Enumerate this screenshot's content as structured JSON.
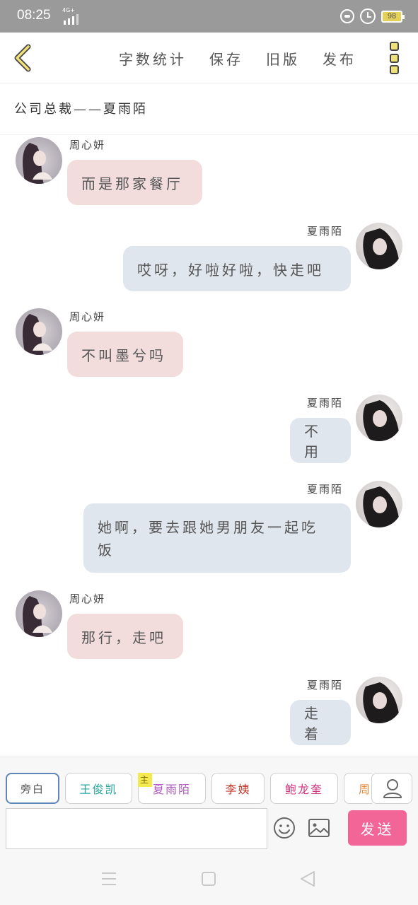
{
  "status": {
    "time": "08:25",
    "network": "4G+",
    "battery": "98"
  },
  "toolbar": {
    "actions": [
      "字数统计",
      "保存",
      "旧版",
      "发布"
    ]
  },
  "title": "公司总裁——夏雨陌",
  "messages": [
    {
      "side": "left",
      "name": "周心妍",
      "text": "而是那家餐厅",
      "color": "pink"
    },
    {
      "side": "right",
      "name": "夏雨陌",
      "text": "哎呀，好啦好啦，快走吧",
      "color": "blue"
    },
    {
      "side": "left",
      "name": "周心妍",
      "text": "不叫墨兮吗",
      "color": "pink"
    },
    {
      "side": "right",
      "name": "夏雨陌",
      "text": "不用",
      "color": "blue"
    },
    {
      "side": "right",
      "name": "夏雨陌",
      "text_lines": [
        "她啊，要去跟她男朋友一起吃",
        "饭"
      ],
      "color": "blue"
    },
    {
      "side": "left",
      "name": "周心妍",
      "text": "那行，走吧",
      "color": "pink"
    },
    {
      "side": "right",
      "name": "夏雨陌",
      "text": "走着",
      "color": "blue"
    }
  ],
  "characters": [
    {
      "label": "旁白",
      "color": "#555555",
      "active": true
    },
    {
      "label": "王俊凯",
      "color": "#2aa6a0"
    },
    {
      "label": "夏雨陌",
      "color": "#b05cc0",
      "tag": "主"
    },
    {
      "label": "李姨",
      "color": "#c0392b"
    },
    {
      "label": "鲍龙奎",
      "color": "#d0367e"
    },
    {
      "label": "周",
      "color": "#e88a3a"
    }
  ],
  "composer": {
    "placeholder": "",
    "send_label": "发送"
  },
  "colors": {
    "send": "#f26597",
    "bubble_left": "#f2dcdc",
    "bubble_right": "#dfe6ee",
    "accent_icon": "#f0e07a"
  }
}
